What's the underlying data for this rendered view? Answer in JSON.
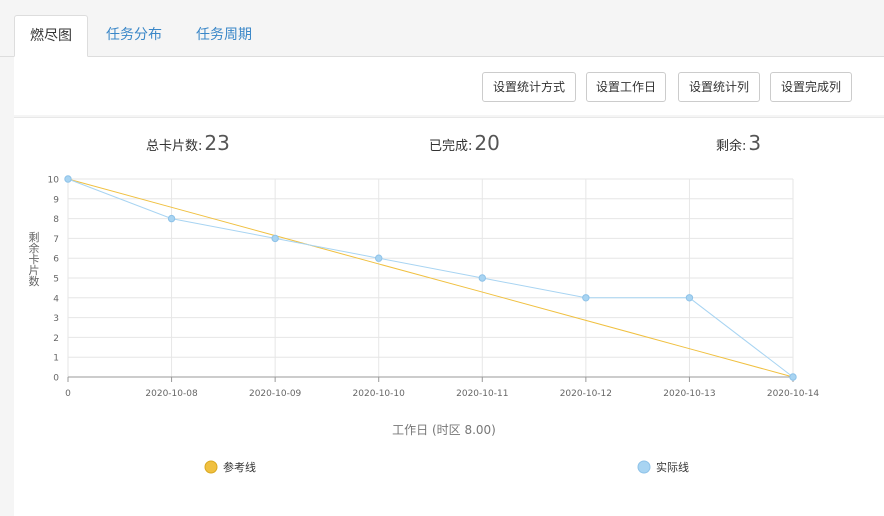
{
  "tabs": [
    {
      "label": "燃尽图"
    },
    {
      "label": "任务分布"
    },
    {
      "label": "任务周期"
    }
  ],
  "toolbar": {
    "buttons": [
      "设置统计方式",
      "设置工作日",
      "设置统计列",
      "设置完成列"
    ]
  },
  "stats": {
    "total_label": "总卡片数:",
    "total_value": "23",
    "done_label": "已完成:",
    "done_value": "20",
    "remaining_label": "剩余:",
    "remaining_value": "3"
  },
  "colors": {
    "reference": "#f0c040",
    "actual": "#a8d4f2",
    "actual_point": "#a8d4f2",
    "grid": "#e6e6e6",
    "axis": "#999999"
  },
  "chart_data": {
    "type": "line",
    "x_categories": [
      "0",
      "2020-10-08",
      "2020-10-09",
      "2020-10-10",
      "2020-10-11",
      "2020-10-12",
      "2020-10-13",
      "2020-10-14"
    ],
    "ylabel": "剩余卡片数",
    "xlabel": "工作日 (时区 8.00)",
    "ylim": [
      0,
      10
    ],
    "y_ticks": [
      0,
      1,
      2,
      3,
      4,
      5,
      6,
      7,
      8,
      9,
      10
    ],
    "grid": true,
    "legend_position": "bottom",
    "series": [
      {
        "name": "参考线",
        "values": [
          10,
          8.57,
          7.14,
          5.71,
          4.29,
          2.86,
          1.43,
          0
        ]
      },
      {
        "name": "实际线",
        "values": [
          10,
          8,
          7,
          6,
          5,
          4,
          4,
          0
        ]
      }
    ]
  }
}
